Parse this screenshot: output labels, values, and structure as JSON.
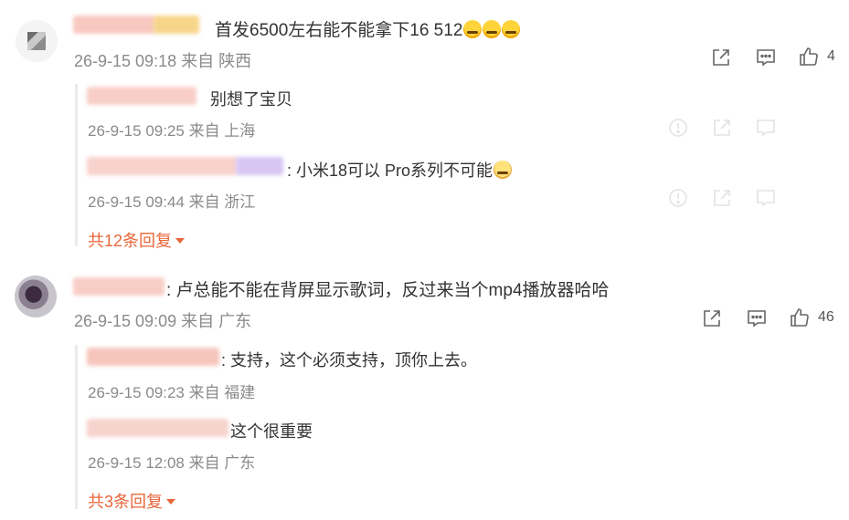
{
  "comments": [
    {
      "text": "首发6500左右能不能拿下16 512",
      "meta": "26-9-15 09:18 来自 陕西",
      "likes": "4",
      "replies": [
        {
          "text": "别想了宝贝",
          "meta": "26-9-15 09:25 来自 上海"
        },
        {
          "text": ": 小米18可以 Pro系列不可能",
          "meta": "26-9-15 09:44 来自 浙江"
        }
      ],
      "more_label": "共12条回复"
    },
    {
      "text": ": 卢总能不能在背屏显示歌词，反过来当个mp4播放器哈哈",
      "meta": "26-9-15 09:09 来自 广东",
      "likes": "46",
      "replies": [
        {
          "text": ": 支持，这个必须支持，顶你上去。",
          "meta": "26-9-15 09:23 来自 福建"
        },
        {
          "text": "这个很重要",
          "meta": "26-9-15 12:08 来自 广东"
        }
      ],
      "more_label": "共3条回复"
    }
  ],
  "icons": {
    "share": "share-icon",
    "comment": "comment-icon",
    "like": "thumbs-up-icon",
    "report": "report-icon",
    "crying_emoji": "crying-emoji-icon",
    "cat_emoji": "cat-emoji-icon"
  },
  "colors": {
    "more_link": "#e8663a",
    "meta_text": "#8a8a8a",
    "thread_line": "#ebebeb"
  }
}
